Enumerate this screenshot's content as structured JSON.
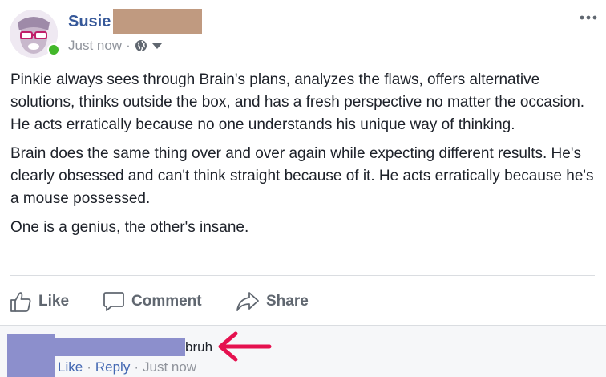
{
  "post": {
    "author_name": "Susie",
    "timestamp": "Just now",
    "separator": "·",
    "privacy_icon": "globe-icon",
    "more_icon": "ellipsis-icon",
    "paragraphs": [
      "Pinkie always sees through Brain's plans, analyzes the flaws, offers alternative solutions, thinks outside the box, and has a fresh perspective no matter the occasion. He acts erratically because no one understands his unique way of thinking.",
      "Brain does the same thing over and over again while expecting different results. He's clearly obsessed and can't think straight because of it. He acts erratically because he's a mouse possessed.",
      "One is a genius, the other's insane."
    ]
  },
  "actions": {
    "like_label": "Like",
    "comment_label": "Comment",
    "share_label": "Share"
  },
  "comment": {
    "text": "bruh",
    "like_label": "Like",
    "reply_label": "Reply",
    "timestamp": "Just now",
    "separator": "·"
  },
  "colors": {
    "author_link": "#365899",
    "online_status": "#42b72a",
    "comment_link": "#4267b2",
    "annotation_arrow": "#e5114f",
    "redaction_name": "#c09a80",
    "redaction_commenter": "#8c8fcc"
  }
}
